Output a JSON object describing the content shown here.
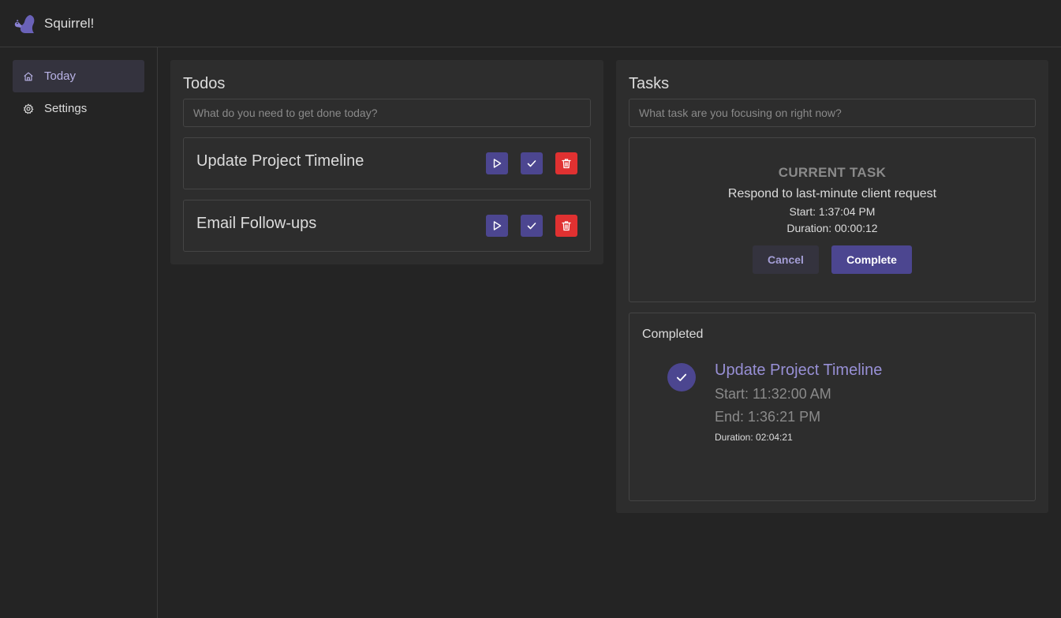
{
  "app": {
    "title": "Squirrel!",
    "logo_icon": "squirrel-icon",
    "accent": "#4c4690",
    "danger": "#e03131"
  },
  "sidebar": {
    "items": [
      {
        "label": "Today",
        "icon": "home-icon",
        "active": true
      },
      {
        "label": "Settings",
        "icon": "gear-icon",
        "active": false
      }
    ]
  },
  "todos": {
    "title": "Todos",
    "placeholder": "What do you need to get done today?",
    "items": [
      {
        "title": "Update Project Timeline"
      },
      {
        "title": "Email Follow-ups"
      }
    ]
  },
  "tasks": {
    "title": "Tasks",
    "placeholder": "What task are you focusing on right now?",
    "current": {
      "heading": "CURRENT TASK",
      "name": "Respond to last-minute client request",
      "start": "Start: 1:37:04 PM",
      "duration": "Duration: 00:00:12",
      "cancel_label": "Cancel",
      "complete_label": "Complete"
    },
    "completed": {
      "heading": "Completed",
      "items": [
        {
          "title": "Update Project Timeline",
          "start": "Start: 11:32:00 AM",
          "end": "End: 1:36:21 PM",
          "duration": "Duration: 02:04:21"
        }
      ]
    }
  }
}
